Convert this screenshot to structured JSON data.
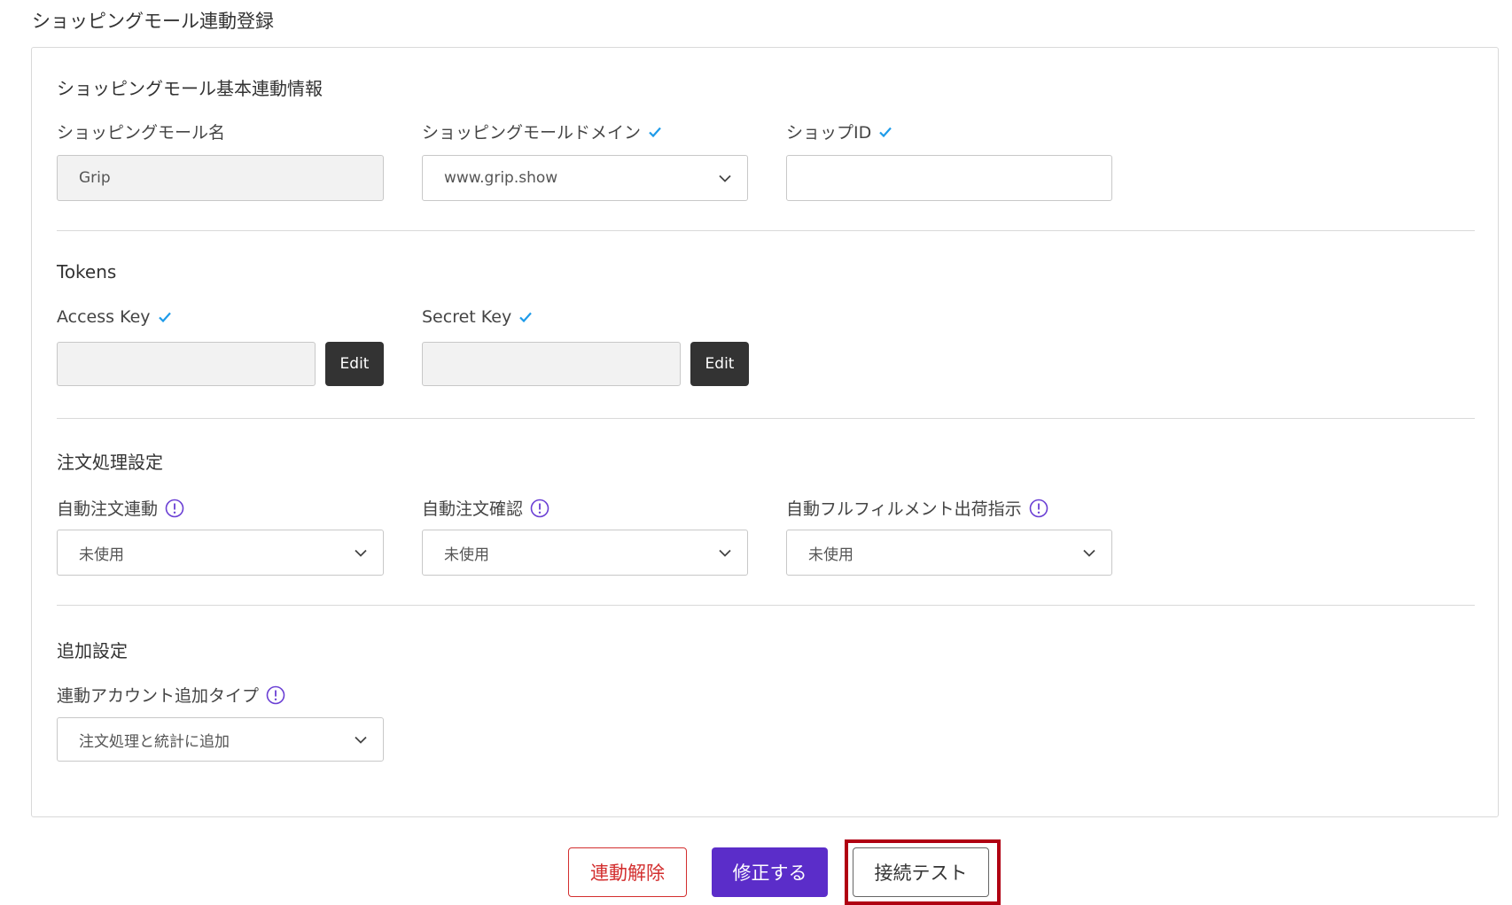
{
  "page": {
    "title": "ショッピングモール連動登録"
  },
  "basic": {
    "section_title": "ショッピングモール基本連動情報",
    "mall_name": {
      "label": "ショッピングモール名",
      "value": "Grip"
    },
    "mall_domain": {
      "label": "ショッピングモールドメイン",
      "value": "www.grip.show"
    },
    "shop_id": {
      "label": "ショップID",
      "value": ""
    }
  },
  "tokens": {
    "section_title": "Tokens",
    "access_key": {
      "label": "Access Key",
      "value": "",
      "edit_label": "Edit"
    },
    "secret_key": {
      "label": "Secret Key",
      "value": "",
      "edit_label": "Edit"
    }
  },
  "orders": {
    "section_title": "注文処理設定",
    "auto_order_sync": {
      "label": "自動注文連動",
      "value": "未使用"
    },
    "auto_order_confirm": {
      "label": "自動注文確認",
      "value": "未使用"
    },
    "auto_fulfillment": {
      "label": "自動フルフィルメント出荷指示",
      "value": "未使用"
    }
  },
  "additional": {
    "section_title": "追加設定",
    "account_add_type": {
      "label": "連動アカウント追加タイプ",
      "value": "注文処理と統計に追加"
    }
  },
  "actions": {
    "unlink_label": "連動解除",
    "save_label": "修正する",
    "test_label": "接続テスト"
  },
  "colors": {
    "accent_purple": "#5b2dc9",
    "check_blue": "#1e9be9",
    "danger_red": "#d32f2f",
    "highlight_red": "#b00012",
    "info_purple": "#6a3fd4"
  },
  "icons": {
    "verified": "check-icon",
    "info": "info-circle-icon",
    "dropdown": "chevron-down-icon"
  }
}
